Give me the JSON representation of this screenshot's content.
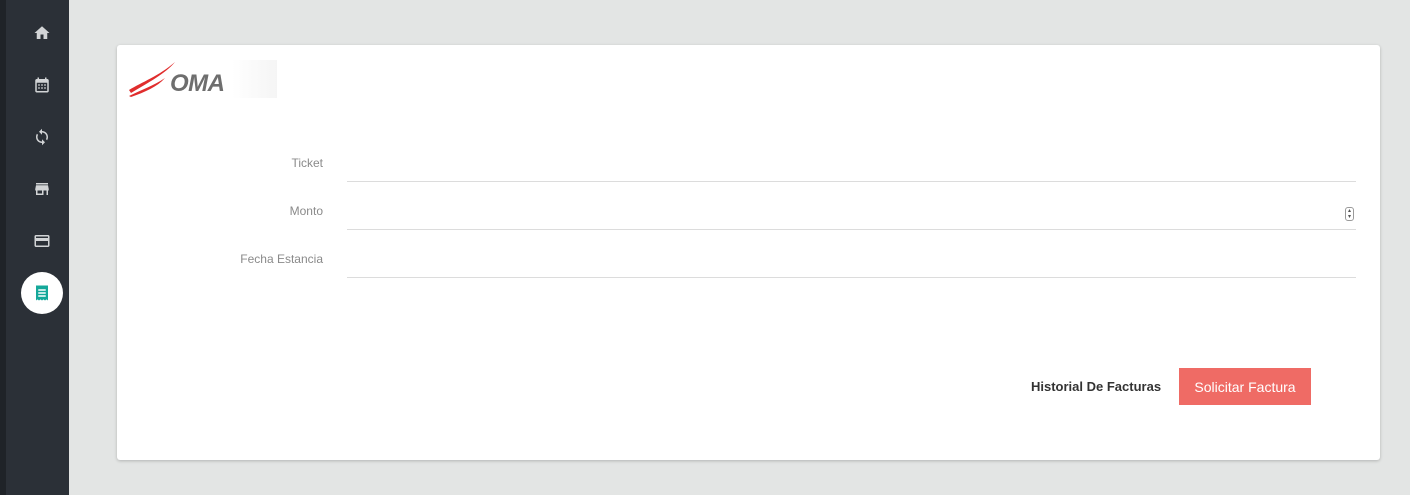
{
  "sidebar": {
    "items": [
      {
        "icon": "home-icon",
        "active": false
      },
      {
        "icon": "calendar-icon",
        "active": false
      },
      {
        "icon": "refresh-icon",
        "active": false
      },
      {
        "icon": "store-icon",
        "active": false
      },
      {
        "icon": "credit-card-icon",
        "active": false
      },
      {
        "icon": "receipt-icon",
        "active": true
      }
    ],
    "active_color": "#15a89a"
  },
  "logo": {
    "text": "OMA",
    "accent_color": "#e02d2d"
  },
  "form": {
    "ticket_label": "Ticket",
    "ticket_value": "",
    "monto_label": "Monto",
    "monto_value": "",
    "fecha_label": "Fecha Estancia",
    "fecha_value": ""
  },
  "actions": {
    "history_label": "Historial De Facturas",
    "submit_label": "Solicitar Factura",
    "submit_color": "#ef6b65"
  }
}
